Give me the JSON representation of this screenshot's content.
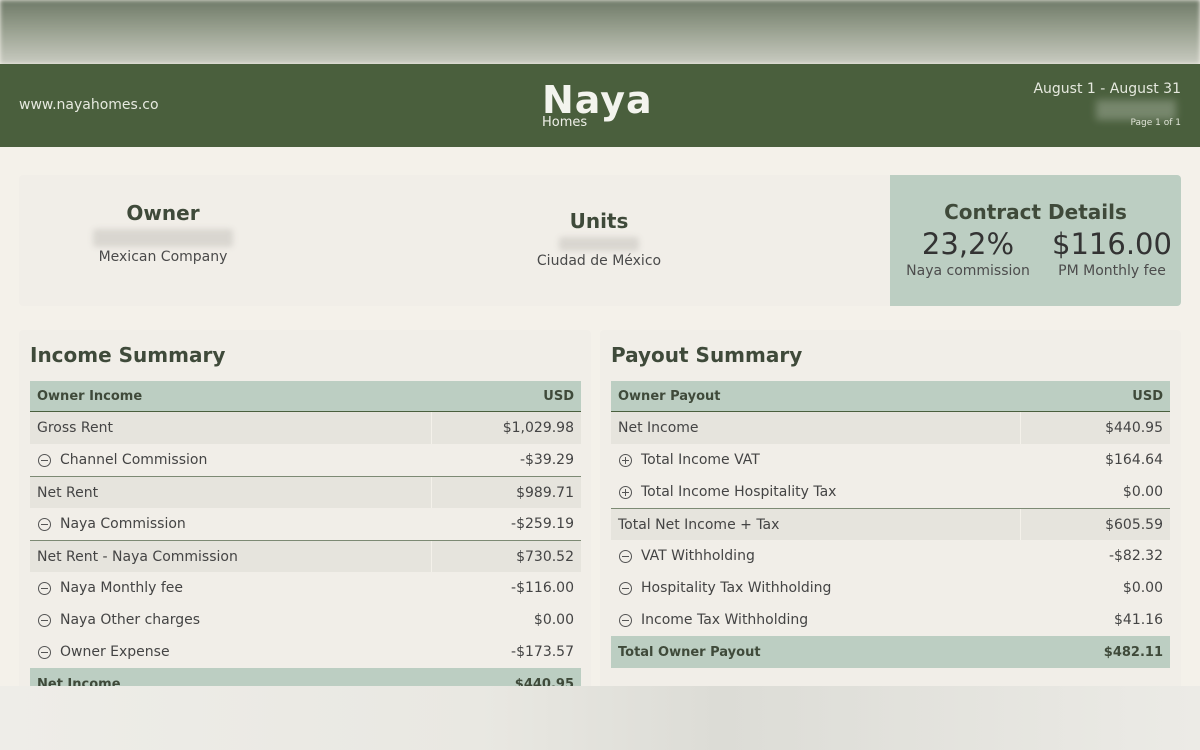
{
  "header": {
    "website": "www.nayahomes.co",
    "logo_word": "Naya",
    "logo_sub": "Homes",
    "period": "August 1 - August 31",
    "page": "Page 1 of 1"
  },
  "info": {
    "owner_title": "Owner",
    "owner_sub": "Mexican Company",
    "units_title": "Units",
    "units_sub": "Ciudad de México",
    "contract_title": "Contract Details",
    "commission_value": "23,2%",
    "commission_label": "Naya commission",
    "fee_value": "$116.00",
    "fee_label": "PM Monthly fee"
  },
  "income": {
    "title": "Income Summary",
    "header_label": "Owner Income",
    "header_currency": "USD",
    "rows": [
      {
        "label": "Gross Rent",
        "value": "$1,029.98",
        "style": "shade",
        "sign": ""
      },
      {
        "label": "Channel Commission",
        "value": "-$39.29",
        "style": "plain",
        "sign": "minus"
      },
      {
        "label": "Net Rent",
        "value": "$989.71",
        "style": "shade divider",
        "sign": ""
      },
      {
        "label": "Naya Commission",
        "value": "-$259.19",
        "style": "plain",
        "sign": "minus"
      },
      {
        "label": "Net Rent - Naya Commission",
        "value": "$730.52",
        "style": "shade divider",
        "sign": ""
      },
      {
        "label": "Naya Monthly fee",
        "value": "-$116.00",
        "style": "plain",
        "sign": "minus"
      },
      {
        "label": "Naya Other charges",
        "value": "$0.00",
        "style": "plain",
        "sign": "minus"
      },
      {
        "label": "Owner Expense",
        "value": "-$173.57",
        "style": "plain",
        "sign": "minus"
      }
    ],
    "total_label": "Net Income",
    "total_value": "$440.95"
  },
  "payout": {
    "title": "Payout Summary",
    "header_label": "Owner Payout",
    "header_currency": "USD",
    "rows": [
      {
        "label": "Net Income",
        "value": "$440.95",
        "style": "shade",
        "sign": ""
      },
      {
        "label": "Total Income VAT",
        "value": "$164.64",
        "style": "plain",
        "sign": "plus"
      },
      {
        "label": "Total Income Hospitality Tax",
        "value": "$0.00",
        "style": "plain",
        "sign": "plus"
      },
      {
        "label": "Total Net Income + Tax",
        "value": "$605.59",
        "style": "shade divider",
        "sign": ""
      },
      {
        "label": "VAT Withholding",
        "value": "-$82.32",
        "style": "plain",
        "sign": "minus"
      },
      {
        "label": "Hospitality Tax Withholding",
        "value": "$0.00",
        "style": "plain",
        "sign": "minus"
      },
      {
        "label": "Income Tax Withholding",
        "value": "$41.16",
        "style": "plain",
        "sign": "minus"
      }
    ],
    "total_label": "Total Owner Payout",
    "total_value": "$482.11"
  }
}
